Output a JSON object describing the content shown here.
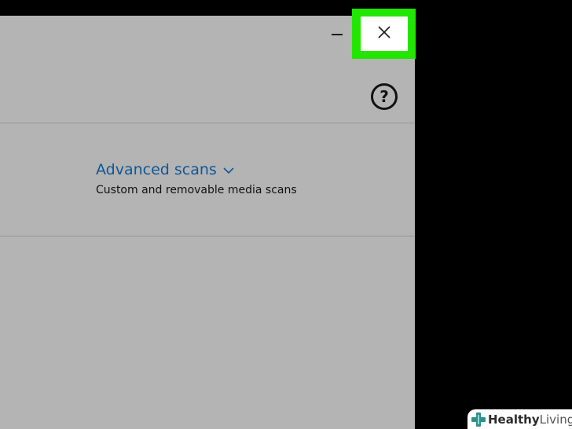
{
  "window": {
    "background": "#b4b4b4"
  },
  "titlebar": {
    "minimize_icon": "minimize-icon",
    "close_icon": "close-icon",
    "close_highlight_color": "#22e600"
  },
  "toolbar": {
    "help_label": "?",
    "help_icon": "help-icon"
  },
  "scans": {
    "advanced_label": "Advanced scans",
    "advanced_subtitle": "Custom and removable media scans",
    "link_color": "#0f5896",
    "chevron_icon": "chevron-down-icon"
  },
  "watermark": {
    "logo_icon": "healthy-living-logo",
    "brand_strong": "Healthy",
    "brand_light": " Living"
  }
}
